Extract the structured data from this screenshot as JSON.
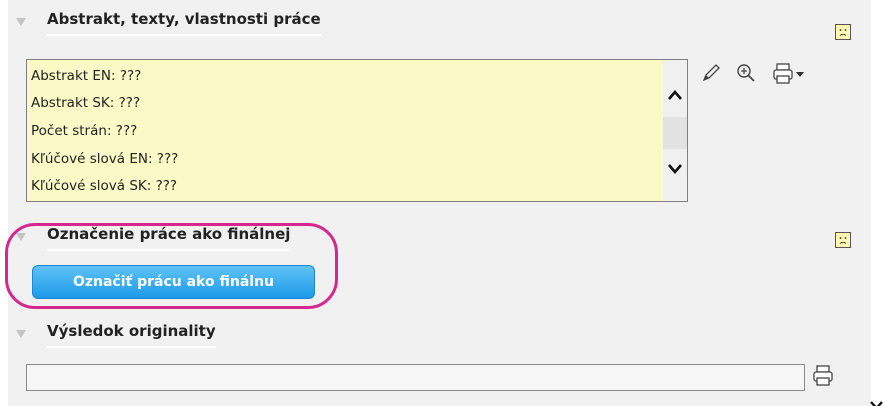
{
  "sections": {
    "abstract": {
      "title": "Abstrakt, texty, vlastnosti práce",
      "rows": [
        "Abstrakt EN: ???",
        "Abstrakt SK: ???",
        "Počet strán: ???",
        "Kľúčové slová EN: ???",
        "Kľúčové slová SK: ???"
      ]
    },
    "final": {
      "title": "Označenie práce ako finálnej",
      "button_label": "Označiť prácu ako finálnu"
    },
    "originality": {
      "title": "Výsledok originality",
      "input_value": ""
    }
  },
  "icons": {
    "collapse": "triangle-down-icon",
    "status": "sad-face-icon",
    "edit": "pencil-icon",
    "zoom": "zoom-in-icon",
    "print": "printer-icon",
    "scroll_up": "chevron-up-icon",
    "scroll_down": "chevron-down-icon"
  },
  "colors": {
    "info_box_bg": "#fafac7",
    "button_bg": "#1c9ae8",
    "highlight": "#d4288f",
    "panel_bg": "#f1f1f1"
  }
}
